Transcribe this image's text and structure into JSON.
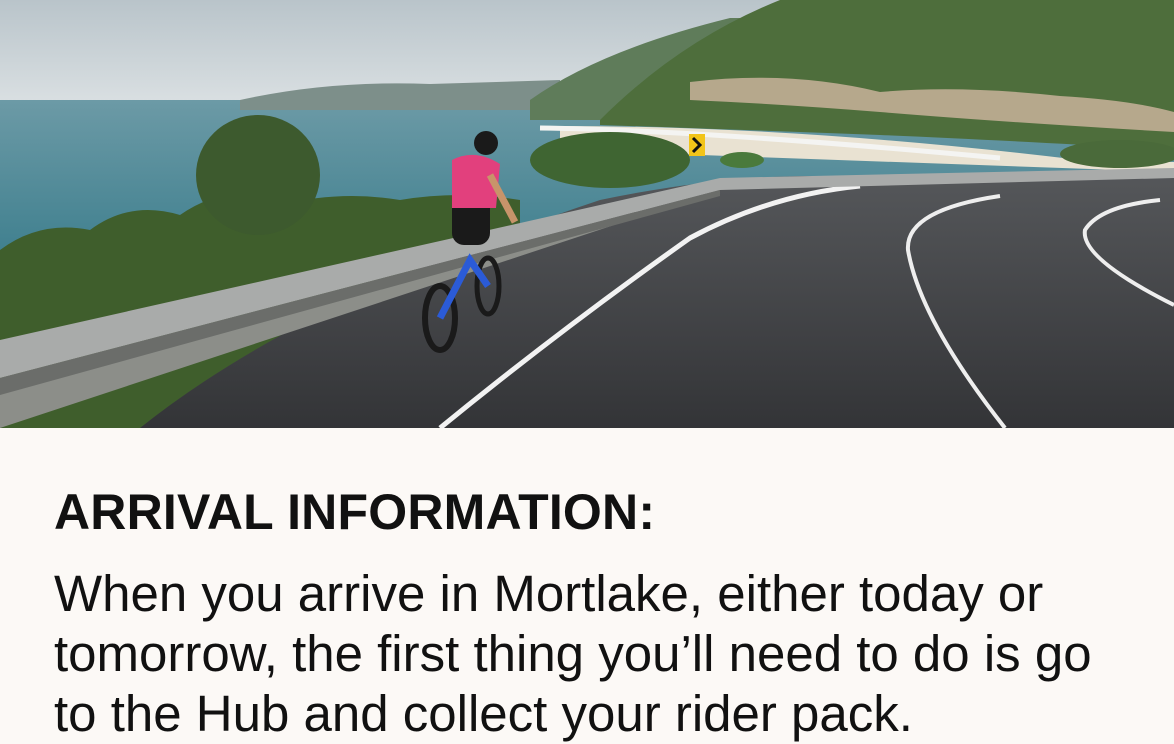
{
  "hero": {
    "icon": "cyclist-coastal-road-photo",
    "colors": {
      "sky": "#c9d3d8",
      "sea": "#4f8c9b",
      "hill": "#4e6e3c",
      "road": "#3c3d40",
      "jersey": "#e2407d"
    }
  },
  "article": {
    "heading": "ARRIVAL INFORMATION:",
    "body": "When you arrive in Mortlake, either today or tomorrow, the first thing you’ll need to do is go to the Hub and collect your rider pack."
  },
  "colors": {
    "background": "#fcf9f6",
    "text": "#111111"
  }
}
